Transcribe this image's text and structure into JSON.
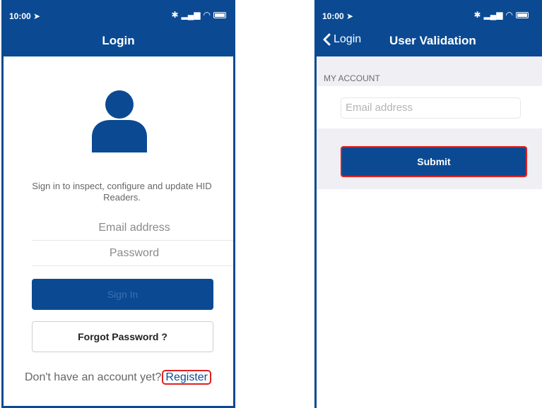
{
  "left": {
    "status": {
      "time": "10:00"
    },
    "nav": {
      "title": "Login"
    },
    "description": "Sign in to inspect, configure and update HID Readers.",
    "email_placeholder": "Email address",
    "password_placeholder": "Password",
    "signin_label": "Sign In",
    "forgot_label": "Forgot Password ?",
    "no_account_text": "Don't have an account yet?",
    "register_label": "Register"
  },
  "right": {
    "status": {
      "time": "10:00"
    },
    "nav": {
      "back_label": "Login",
      "title": "User Validation"
    },
    "section_header": "MY ACCOUNT",
    "email_placeholder": "Email address",
    "submit_label": "Submit"
  },
  "colors": {
    "brand": "#0b4a93",
    "highlight": "#e02020",
    "background_section": "#efeff4"
  },
  "icons": [
    "location-arrow-icon",
    "bluetooth-icon",
    "cellular-signal-icon",
    "wifi-icon",
    "battery-icon",
    "user-avatar-icon",
    "back-chevron-icon"
  ]
}
